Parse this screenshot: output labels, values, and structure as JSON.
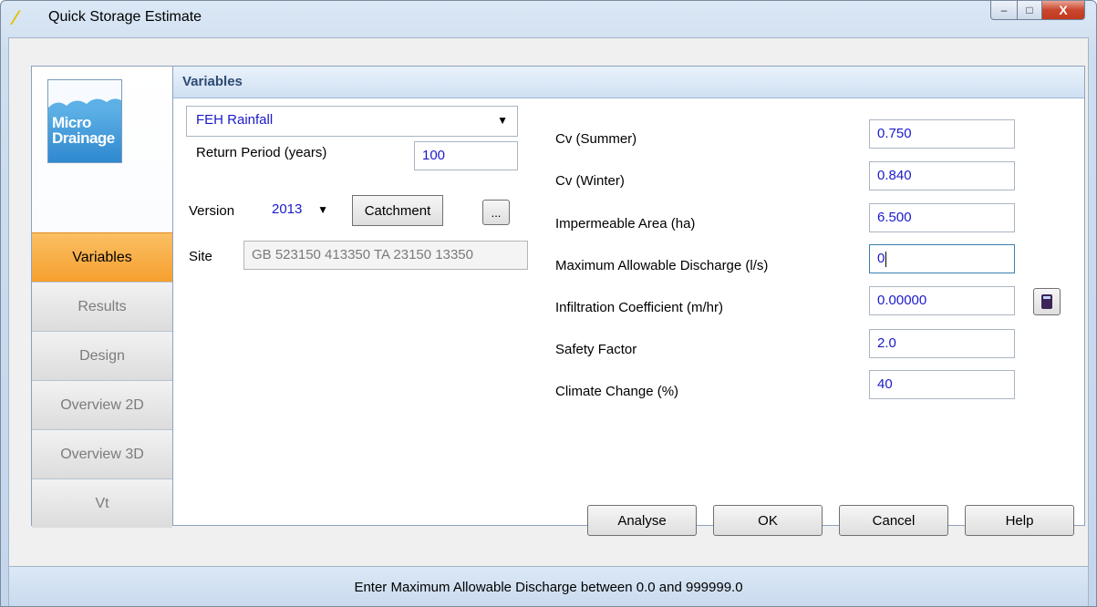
{
  "window": {
    "title": "Quick Storage Estimate",
    "minimize": "–",
    "maximize": "□",
    "close": "X"
  },
  "logo": {
    "line1": "Micro",
    "line2": "Drainage"
  },
  "nav": {
    "items": [
      "Variables",
      "Results",
      "Design",
      "Overview 2D",
      "Overview 3D",
      "Vt"
    ],
    "active": "Variables"
  },
  "panel": {
    "title": "Variables"
  },
  "rainfall": {
    "selected": "FEH Rainfall"
  },
  "return_period": {
    "label": "Return Period (years)",
    "value": "100"
  },
  "version": {
    "label": "Version",
    "selected": "2013"
  },
  "catchment_button": "Catchment",
  "browse_button": "...",
  "site": {
    "label": "Site",
    "value": "GB 523150 413350 TA 23150 13350"
  },
  "params": {
    "cv_summer": {
      "label": "Cv (Summer)",
      "value": "0.750"
    },
    "cv_winter": {
      "label": "Cv (Winter)",
      "value": "0.840"
    },
    "imp_area": {
      "label": "Impermeable Area (ha)",
      "value": "6.500"
    },
    "max_discharge": {
      "label": "Maximum Allowable Discharge (l/s)",
      "value": "0"
    },
    "infiltration": {
      "label": "Infiltration Coefficient (m/hr)",
      "value": "0.00000"
    },
    "safety": {
      "label": "Safety Factor",
      "value": "2.0"
    },
    "climate": {
      "label": "Climate Change (%)",
      "value": "40"
    }
  },
  "buttons": {
    "analyse": "Analyse",
    "ok": "OK",
    "cancel": "Cancel",
    "help": "Help"
  },
  "status": "Enter Maximum Allowable Discharge between 0.0 and 999999.0",
  "icons": {
    "app": "pencil-icon",
    "calculator": "calculator-icon",
    "dropdown": "chevron-down-icon"
  },
  "colors": {
    "active_tab": "#f6a02f",
    "value_text": "#1a1acc",
    "close_button": "#c9462c"
  }
}
